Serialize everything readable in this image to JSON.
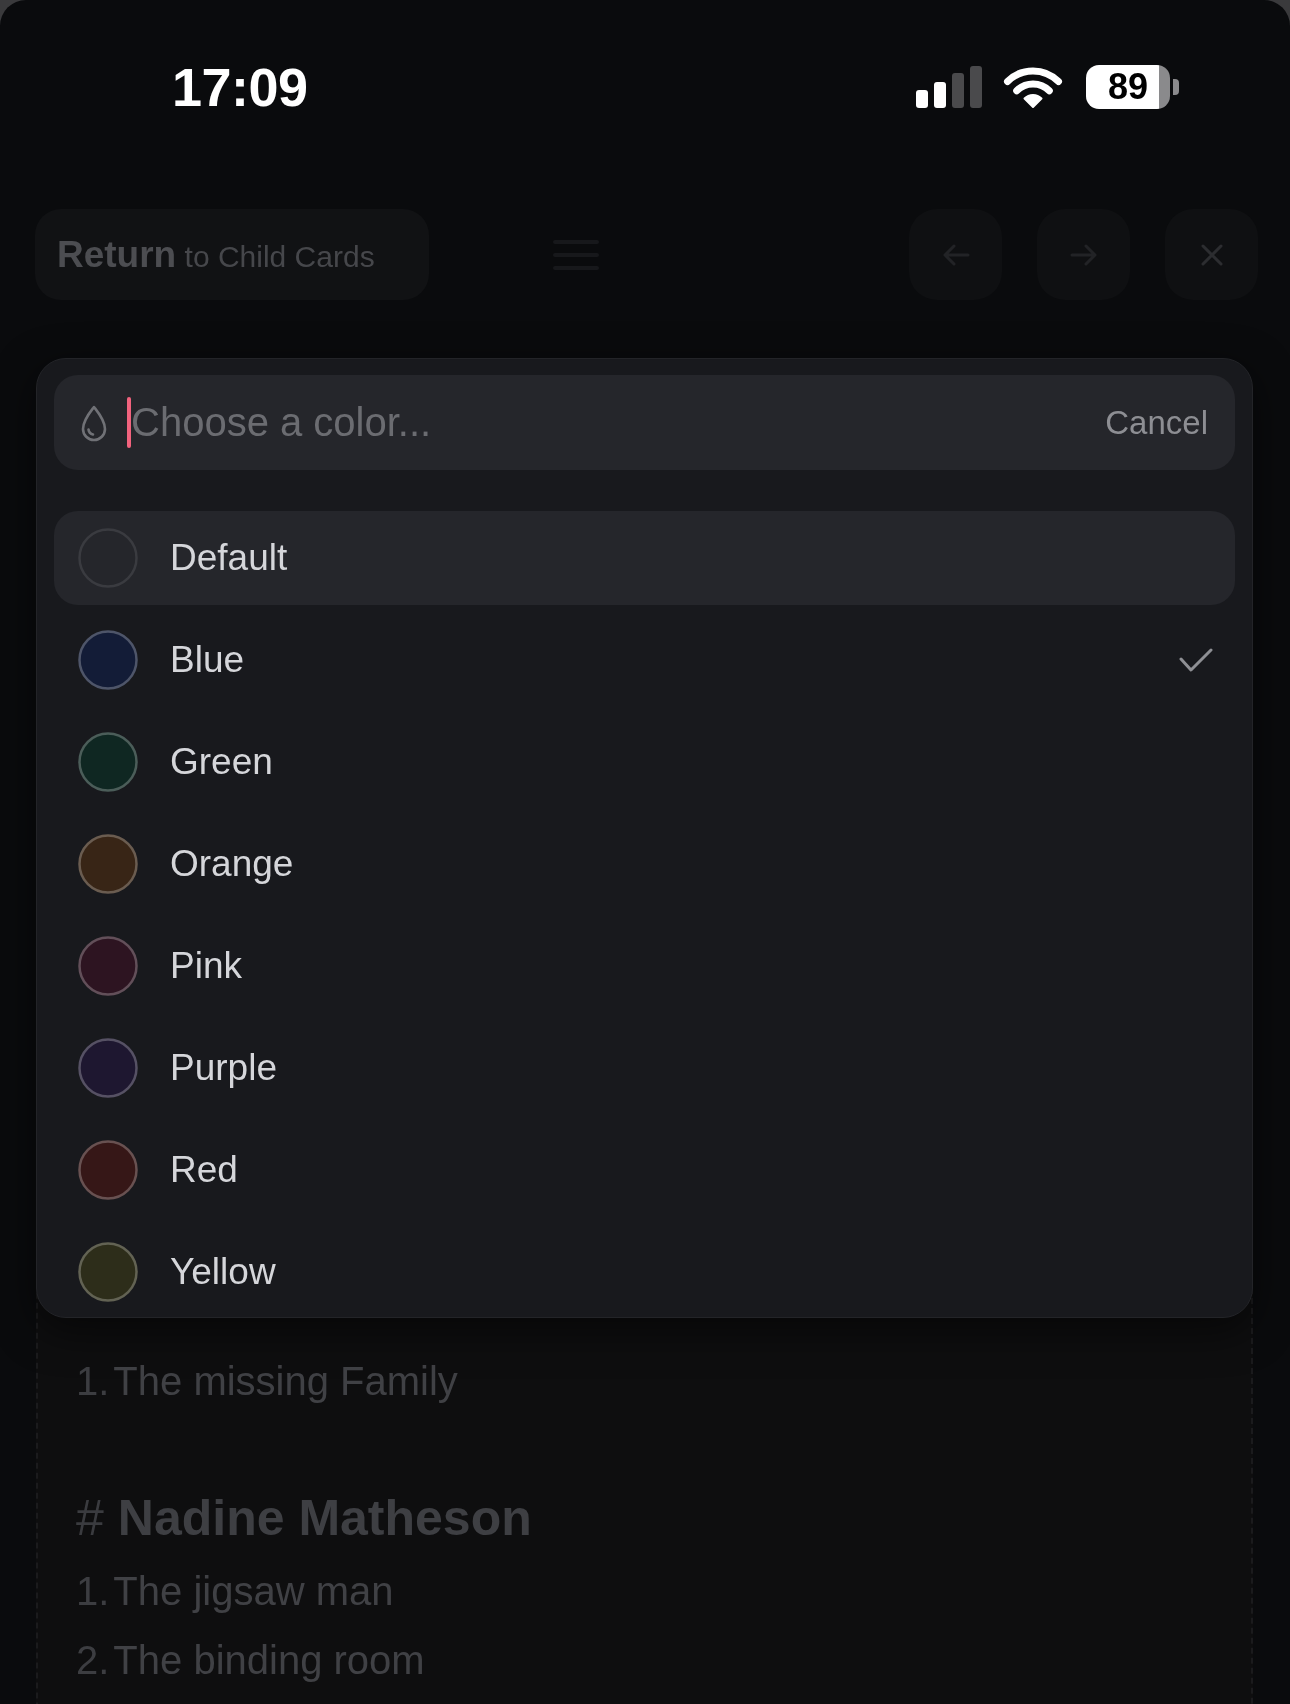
{
  "status_bar": {
    "time": "17:09",
    "battery": "89"
  },
  "header": {
    "return_button": "**Return** to Child Cards"
  },
  "color_picker": {
    "search": {
      "placeholder": "Choose a color...",
      "cancel": "Cancel"
    },
    "options": [
      {
        "label": "Default",
        "highlighted": true,
        "selected": false
      },
      {
        "label": "Blue",
        "color": "#131c37",
        "highlighted": false,
        "selected": true
      },
      {
        "label": "Green",
        "color": "#0f2722",
        "highlighted": false,
        "selected": false
      },
      {
        "label": "Orange",
        "color": "#382516",
        "highlighted": false,
        "selected": false
      },
      {
        "label": "Pink",
        "color": "#2d1421",
        "highlighted": false,
        "selected": false
      },
      {
        "label": "Purple",
        "color": "#1e1730",
        "highlighted": false,
        "selected": false
      },
      {
        "label": "Red",
        "color": "#361717",
        "highlighted": false,
        "selected": false
      },
      {
        "label": "Yellow",
        "color": "#2d2d1a",
        "highlighted": false,
        "selected": false
      }
    ]
  },
  "background_card": {
    "lines": [
      {
        "kind": "list_item",
        "number": "1.",
        "text": "The missing Family"
      },
      {
        "kind": "heading",
        "marker": "#",
        "text": "Nadine Matheson"
      },
      {
        "kind": "list_item",
        "number": "1.",
        "text": "The jigsaw man"
      },
      {
        "kind": "list_item",
        "number": "2.",
        "text": "The binding room"
      }
    ]
  }
}
